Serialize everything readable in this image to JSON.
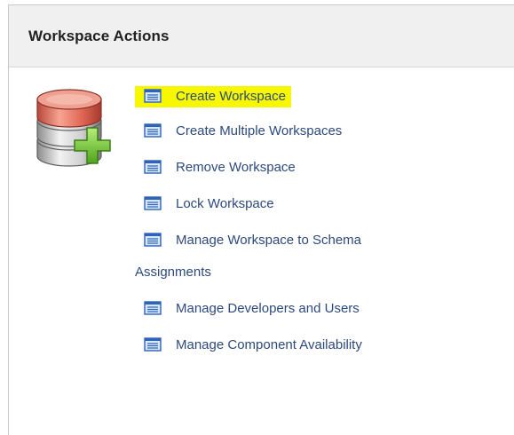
{
  "panel": {
    "title": "Workspace Actions"
  },
  "icons": {
    "database": "database-add-icon",
    "action": "list-document-icon"
  },
  "colors": {
    "link": "#2d4a7c",
    "highlight": "#f7f700",
    "header_bg": "#f0f0f0",
    "db_top": "#e46a5a",
    "plus": "#7ecf3a"
  },
  "actions": [
    {
      "label": "Create Workspace",
      "highlighted": true
    },
    {
      "label": "Create Multiple Workspaces"
    },
    {
      "label": "Remove Workspace"
    },
    {
      "label": "Lock Workspace"
    },
    {
      "label_line1": "Manage Workspace to Schema",
      "label_line2": "Assignments"
    },
    {
      "label": "Manage Developers and Users"
    },
    {
      "label": "Manage Component Availability"
    }
  ]
}
